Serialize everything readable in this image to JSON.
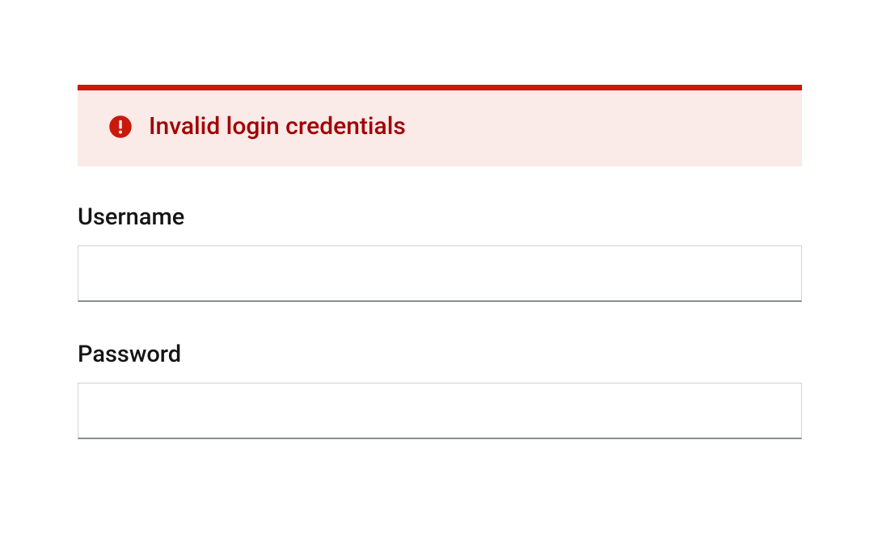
{
  "alert": {
    "message": "Invalid login credentials"
  },
  "form": {
    "username": {
      "label": "Username",
      "value": ""
    },
    "password": {
      "label": "Password",
      "value": ""
    }
  }
}
